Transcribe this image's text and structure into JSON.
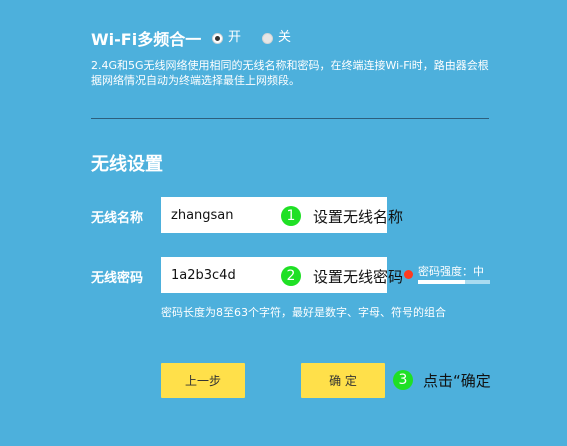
{
  "wifi_multiband": {
    "title": "Wi-Fi多频合一",
    "options": [
      {
        "label": "开",
        "selected": true
      },
      {
        "label": "关",
        "selected": false
      }
    ],
    "description": "2.4G和5G无线网络使用相同的无线名称和密码，在终端连接Wi-Fi时，路由器会根据网络情况自动为终端选择最佳上网频段。"
  },
  "wireless_settings": {
    "section_title": "无线设置",
    "ssid": {
      "label": "无线名称",
      "value": "zhangsan"
    },
    "password": {
      "label": "无线密码",
      "value": "1a2b3c4d"
    },
    "strength": {
      "label": "密码强度：中",
      "level": 0.65
    },
    "hint": "密码长度为8至63个字符，最好是数字、字母、符号的组合"
  },
  "buttons": {
    "prev_label": "上一步",
    "confirm_label": "确 定"
  },
  "annotations": [
    {
      "number": "1",
      "text": "设置无线名称"
    },
    {
      "number": "2",
      "text": "设置无线密码"
    },
    {
      "number": "3",
      "text": "点击“确定"
    }
  ],
  "colors": {
    "background": "#4db0dc",
    "button": "#ffe04a",
    "step_badge": "#1fe025",
    "strength_dot": "#ff3b1f",
    "divider": "#2d5f7d"
  }
}
